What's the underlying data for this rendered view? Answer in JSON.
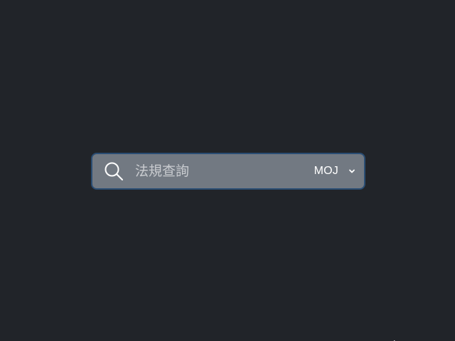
{
  "search": {
    "placeholder": "法規查詢",
    "value": ""
  },
  "source_selector": {
    "selected": "MOJ"
  },
  "icons": {
    "search": "search-icon",
    "dropdown": "chevron-down-icon",
    "pointer": "mouse-cursor-icon"
  },
  "colors": {
    "background": "#212429",
    "search_bar": "#727982",
    "search_bar_border": "#2a4d73",
    "text": "#ffffff",
    "placeholder": "#c9ccd0"
  }
}
